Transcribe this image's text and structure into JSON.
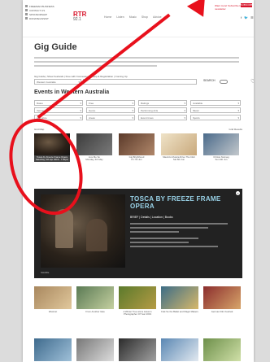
{
  "header": {
    "side_links": [
      "FREEMAN BUSINESS",
      "CONTACT US",
      "SPONSORSHIP",
      "DONATE/ASSIST"
    ],
    "logo_text": "RTR",
    "logo_freq": "92.1",
    "nav": [
      "Home",
      "Listen",
      "Music",
      "Shop",
      "Advice"
    ],
    "top_link": "Want more! Subscribe to our newsletter",
    "subscribe_label": "SUBSCRIBE",
    "social": [
      "f",
      "🐦",
      "☰"
    ]
  },
  "page": {
    "title": "Gig Guide",
    "filter_tabs": "Gig Guide | Show Festivals | Free with Concessions | Help & Registration | Coming Up",
    "search_label": "SEARCH",
    "region_select": "Western Australia",
    "section_title": "Events in Western Australia",
    "list_label": "Grid  Map",
    "list_right": "Grid Results"
  },
  "filters": [
    [
      "Dates",
      "Free",
      "Ratings",
      "Available"
    ],
    [
      "Venues",
      "Genre",
      "Performing Acts",
      "Music"
    ],
    [
      "Any price",
      "Areas",
      "Event times",
      "Sports"
    ]
  ],
  "events": [
    {
      "title": "Tosca by Freeze Frame Opera",
      "sub": "Saturday, 6th Apr 2019 - 7.30pm"
    },
    {
      "title": "Live Me So",
      "sub": "Monday, 6th May"
    },
    {
      "title": "Gig Brighthood",
      "sub": "Fri 7th Jun"
    },
    {
      "title": "Mauricio Musica Drive The Club",
      "sub": "Sat 8th Jun"
    },
    {
      "title": "Christo Nutmeg",
      "sub": "Sun 9th Jun"
    }
  ],
  "feature": {
    "title": "TOSCA BY FREEZE FRAME OPERA",
    "date_text": "BRIEF | Details | Location | Books",
    "close": "×",
    "share": "SHARE"
  },
  "bottom_events": [
    {
      "title": "Westnet",
      "sub": "Mon 1st"
    },
    {
      "title": "From Another Idea",
      "sub": "Tue 2nd"
    },
    {
      "title": "A Winter Tree and a Autumn Photographer Of Year 2019",
      "sub": "Wed 3rd"
    },
    {
      "title": "Folk So the Ballet and Magic Makers",
      "sub": "Thu 4th"
    },
    {
      "title": "German Film Festival",
      "sub": "Fri 5th"
    }
  ],
  "colors": {
    "accent_red": "#d7142a",
    "annotation_red": "#e8101c",
    "feature_title": "#9ad3e8"
  }
}
